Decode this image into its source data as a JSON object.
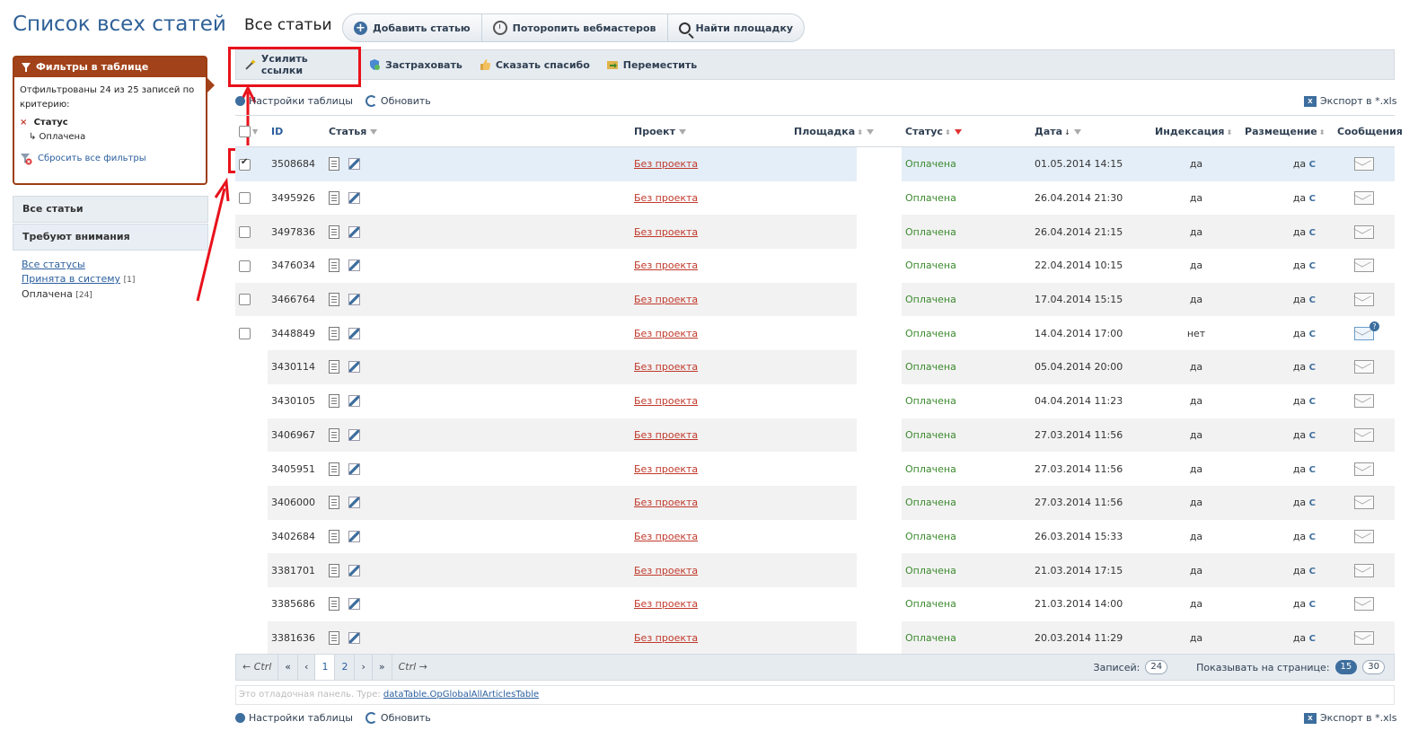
{
  "page_title": "Список всех статей",
  "filters": {
    "header": "Фильтры в таблице",
    "summary": "Отфильтрованы 24 из 25 записей по критерию:",
    "criterion_label": "Статус",
    "criterion_value": "↳ Оплачена",
    "reset": "Сбросить все фильтры"
  },
  "nav": {
    "all": "Все статьи",
    "attention": "Требуют внимания"
  },
  "status_list": {
    "all": "Все статусы",
    "accepted": "Принята в систему",
    "accepted_count": "[1]",
    "paid": "Оплачена",
    "paid_count": "[24]"
  },
  "section_title": "Все статьи",
  "top_buttons": {
    "add": "Добавить статью",
    "hurry": "Поторопить вебмастеров",
    "find": "Найти площадку"
  },
  "actions": {
    "boost": "Усилить ссылки",
    "insure": "Застраховать",
    "thanks": "Сказать спасибо",
    "move": "Переместить"
  },
  "util": {
    "settings": "Настройки таблицы",
    "refresh": "Обновить",
    "export": "Экспорт в *.xls"
  },
  "columns": {
    "id": "ID",
    "article": "Статья",
    "project": "Проект",
    "site": "Площадка",
    "status": "Статус",
    "date": "Дата",
    "indexing": "Индексация",
    "placement": "Размещение",
    "messages": "Сообщения"
  },
  "rows": [
    {
      "id": "3508684",
      "project": "Без проекта",
      "status": "Оплачена",
      "date": "01.05.2014 14:15",
      "indexed": "да",
      "placed": "да"
    },
    {
      "id": "3495926",
      "project": "Без проекта",
      "status": "Оплачена",
      "date": "26.04.2014 21:30",
      "indexed": "да",
      "placed": "да"
    },
    {
      "id": "3497836",
      "project": "Без проекта",
      "status": "Оплачена",
      "date": "26.04.2014 21:15",
      "indexed": "да",
      "placed": "да"
    },
    {
      "id": "3476034",
      "project": "Без проекта",
      "status": "Оплачена",
      "date": "22.04.2014 10:15",
      "indexed": "да",
      "placed": "да"
    },
    {
      "id": "3466764",
      "project": "Без проекта",
      "status": "Оплачена",
      "date": "17.04.2014 15:15",
      "indexed": "да",
      "placed": "да"
    },
    {
      "id": "3448849",
      "project": "Без проекта",
      "status": "Оплачена",
      "date": "14.04.2014 17:00",
      "indexed": "нет",
      "placed": "да",
      "msg_badge": "?"
    },
    {
      "id": "3430114",
      "project": "Без проекта",
      "status": "Оплачена",
      "date": "05.04.2014 20:00",
      "indexed": "да",
      "placed": "да"
    },
    {
      "id": "3430105",
      "project": "Без проекта",
      "status": "Оплачена",
      "date": "04.04.2014 11:23",
      "indexed": "да",
      "placed": "да"
    },
    {
      "id": "3406967",
      "project": "Без проекта",
      "status": "Оплачена",
      "date": "27.03.2014 11:56",
      "indexed": "да",
      "placed": "да"
    },
    {
      "id": "3405951",
      "project": "Без проекта",
      "status": "Оплачена",
      "date": "27.03.2014 11:56",
      "indexed": "да",
      "placed": "да"
    },
    {
      "id": "3406000",
      "project": "Без проекта",
      "status": "Оплачена",
      "date": "27.03.2014 11:56",
      "indexed": "да",
      "placed": "да"
    },
    {
      "id": "3402684",
      "project": "Без проекта",
      "status": "Оплачена",
      "date": "26.03.2014 15:33",
      "indexed": "да",
      "placed": "да"
    },
    {
      "id": "3381701",
      "project": "Без проекта",
      "status": "Оплачена",
      "date": "21.03.2014 17:15",
      "indexed": "да",
      "placed": "да"
    },
    {
      "id": "3385686",
      "project": "Без проекта",
      "status": "Оплачена",
      "date": "21.03.2014 14:00",
      "indexed": "да",
      "placed": "да"
    },
    {
      "id": "3381636",
      "project": "Без проекта",
      "status": "Оплачена",
      "date": "20.03.2014 11:29",
      "indexed": "да",
      "placed": "да"
    }
  ],
  "pager": {
    "prev_hint": "← Ctrl",
    "first": "«",
    "prev": "‹",
    "pages": [
      "1",
      "2"
    ],
    "next": "›",
    "last": "»",
    "next_hint": "Ctrl →",
    "records_label": "Записей:",
    "records": "24",
    "per_page_label": "Показывать на странице:",
    "per_page": [
      "15",
      "30"
    ]
  },
  "debug": {
    "text": "Это отладочная панель.",
    "type_label": "Type:",
    "type_value": "dataTable.OpGlobalAllArticlesTable"
  },
  "colors": {
    "accent": "#2f6198",
    "filter": "#a2421a",
    "highlight": "#e8121b",
    "ok": "#3c8a2e",
    "link_red": "#c0392b"
  }
}
